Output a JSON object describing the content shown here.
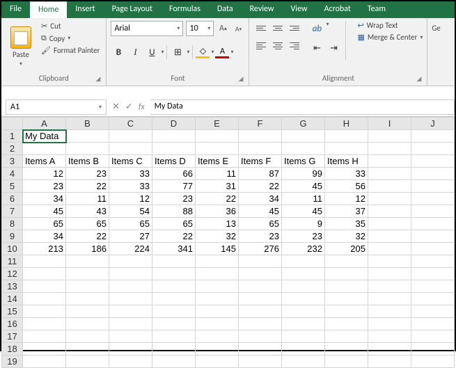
{
  "tabs": [
    "File",
    "Home",
    "Insert",
    "Page Layout",
    "Formulas",
    "Data",
    "Review",
    "View",
    "Acrobat",
    "Team"
  ],
  "active_tab": "Home",
  "ribbon": {
    "clipboard": {
      "paste": "Paste",
      "cut": "Cut",
      "copy": "Copy",
      "painter": "Format Painter",
      "label": "Clipboard"
    },
    "font": {
      "name": "Arial",
      "size": "10",
      "bold": "B",
      "italic": "I",
      "underline": "U",
      "label": "Font"
    },
    "alignment": {
      "wrap": "Wrap Text",
      "merge": "Merge & Center",
      "label": "Alignment"
    },
    "general": {
      "partial": "Ge"
    }
  },
  "namebox": "A1",
  "formula": "My Data",
  "columns": [
    "A",
    "B",
    "C",
    "D",
    "E",
    "F",
    "G",
    "H",
    "I",
    "J"
  ],
  "row_count": 19,
  "active_cell": {
    "row": 1,
    "col": 0
  },
  "chart_data": {
    "type": "table",
    "title": "My Data",
    "headers": [
      "Items A",
      "Items B",
      "Items C",
      "Items D",
      "Items E",
      "Items F",
      "Items G",
      "Items H"
    ],
    "rows": [
      [
        12,
        23,
        33,
        66,
        11,
        87,
        99,
        33
      ],
      [
        23,
        22,
        33,
        77,
        31,
        22,
        45,
        56
      ],
      [
        34,
        11,
        12,
        23,
        22,
        34,
        11,
        12
      ],
      [
        45,
        43,
        54,
        88,
        36,
        45,
        45,
        37
      ],
      [
        65,
        65,
        65,
        65,
        13,
        65,
        9,
        35
      ],
      [
        34,
        22,
        27,
        22,
        32,
        23,
        23,
        32
      ],
      [
        213,
        186,
        224,
        341,
        145,
        276,
        232,
        205
      ]
    ]
  }
}
